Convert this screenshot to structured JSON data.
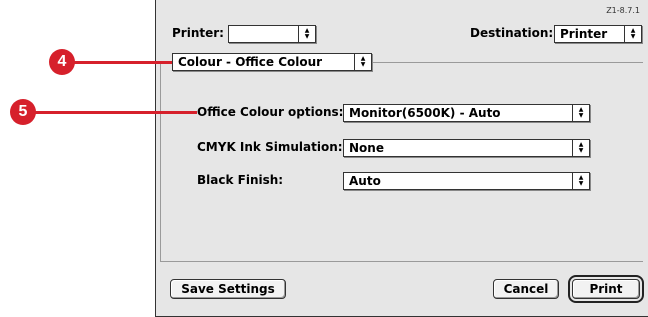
{
  "dialog": {
    "version": "Z1-8.7.1",
    "printer_label": "Printer:",
    "printer_value": "",
    "destination_label": "Destination:",
    "destination_value": "Printer",
    "panel_selector": "Colour - Office Colour"
  },
  "options": [
    {
      "label": "Office Colour options:",
      "value": "Monitor(6500K) - Auto"
    },
    {
      "label": "CMYK Ink Simulation:",
      "value": "None"
    },
    {
      "label": "Black Finish:",
      "value": "Auto"
    }
  ],
  "buttons": {
    "save_settings": "Save Settings",
    "cancel": "Cancel",
    "print": "Print"
  },
  "callouts": {
    "one": "4",
    "two": "5"
  },
  "colors": {
    "callout": "#d6202b",
    "dialog_bg": "#e6e6e6"
  }
}
